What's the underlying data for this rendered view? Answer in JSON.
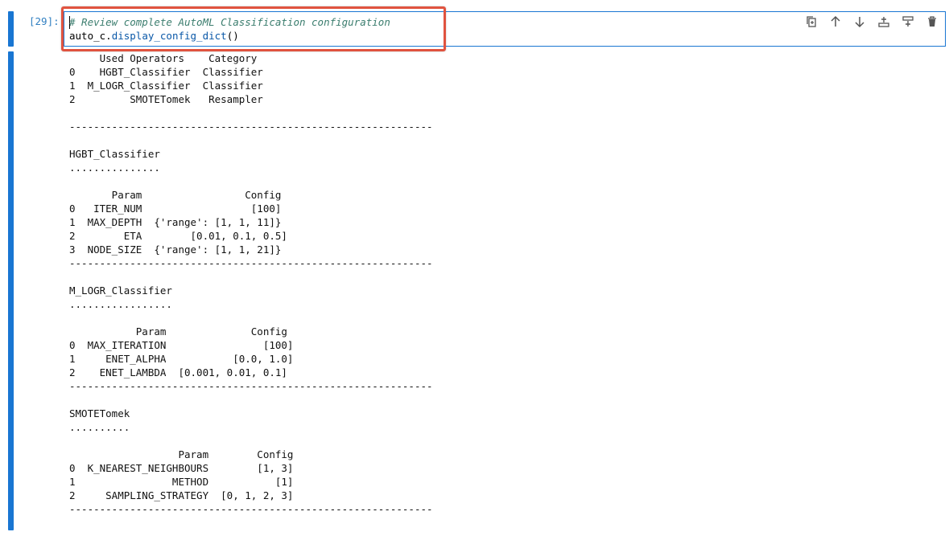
{
  "cell": {
    "prompt": "[29]:",
    "code_comment": "# Review complete AutoML Classification configuration",
    "code_obj": "auto_c.",
    "code_fn": "display_config_dict",
    "code_args": "()"
  },
  "toolbar": {
    "icons": [
      "duplicate-icon",
      "move-up-icon",
      "move-down-icon",
      "insert-above-icon",
      "insert-below-icon",
      "delete-icon"
    ]
  },
  "output": {
    "lines": [
      "     Used Operators    Category",
      "0    HGBT_Classifier  Classifier",
      "1  M_LOGR_Classifier  Classifier",
      "2         SMOTETomek   Resampler",
      "",
      "------------------------------------------------------------",
      "",
      "HGBT_Classifier",
      "...............",
      "",
      "       Param                 Config",
      "0   ITER_NUM                  [100]",
      "1  MAX_DEPTH  {'range': [1, 1, 11]}",
      "2        ETA        [0.01, 0.1, 0.5]",
      "3  NODE_SIZE  {'range': [1, 1, 21]}",
      "------------------------------------------------------------",
      "",
      "M_LOGR_Classifier",
      ".................",
      "",
      "           Param              Config",
      "0  MAX_ITERATION                [100]",
      "1     ENET_ALPHA           [0.0, 1.0]",
      "2    ENET_LAMBDA  [0.001, 0.01, 0.1]",
      "------------------------------------------------------------",
      "",
      "SMOTETomek",
      "..........",
      "",
      "                  Param        Config",
      "0  K_NEAREST_NEIGHBOURS        [1, 3]",
      "1                METHOD           [1]",
      "2     SAMPLING_STRATEGY  [0, 1, 2, 3]",
      "------------------------------------------------------------"
    ]
  }
}
